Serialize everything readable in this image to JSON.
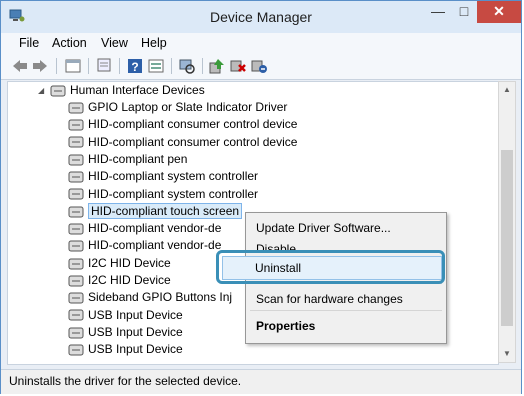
{
  "window": {
    "title": "Device Manager",
    "minimize_glyph": "—",
    "maximize_glyph": "□",
    "close_glyph": "✕"
  },
  "menu": {
    "items": [
      "File",
      "Action",
      "View",
      "Help"
    ]
  },
  "toolbar": {
    "icons": [
      "back-arrow-icon",
      "forward-arrow-icon",
      "properties-icon",
      "computer-icon",
      "help-icon",
      "show-hidden-icon",
      "scan-hardware-icon",
      "update-driver-icon",
      "disable-device-icon",
      "uninstall-device-icon"
    ]
  },
  "tree": {
    "category": {
      "label": "Human Interface Devices",
      "expander": "◢"
    },
    "devices": [
      "GPIO Laptop or Slate Indicator Driver",
      "HID-compliant consumer control device",
      "HID-compliant consumer control device",
      "HID-compliant pen",
      "HID-compliant system controller",
      "HID-compliant system controller",
      "HID-compliant touch screen",
      "HID-compliant vendor-de",
      "HID-compliant vendor-de",
      "I2C HID Device",
      "I2C HID Device",
      "Sideband GPIO Buttons Inj",
      "USB Input Device",
      "USB Input Device",
      "USB Input Device"
    ],
    "selected_index": 6
  },
  "context_menu": {
    "update": "Update Driver Software...",
    "disable": "Disable",
    "uninstall": "Uninstall",
    "scan": "Scan for hardware changes",
    "properties": "Properties"
  },
  "status": {
    "text": "Uninstalls the driver for the selected device."
  },
  "colors": {
    "accent_highlight": "#3a8fb7",
    "selection": "#d9ebf9",
    "close_button": "#c74a42"
  }
}
